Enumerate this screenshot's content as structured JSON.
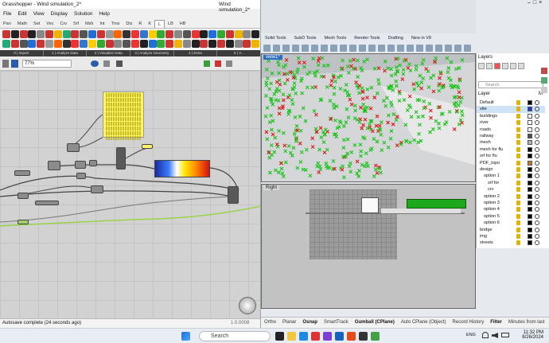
{
  "grasshopper": {
    "title": "Grasshopper - Wind simulation_2*",
    "doc_title": "Wind simulation_2*",
    "menu": [
      "File",
      "Edit",
      "View",
      "Display",
      "Solution",
      "Help"
    ],
    "tabs": [
      "Pan",
      "Math",
      "Set",
      "Vec",
      "Crv",
      "Srf",
      "Msh",
      "Int",
      "Trns",
      "Dis",
      "R",
      "K",
      "L",
      "LB",
      "HB"
    ],
    "active_tab": "L",
    "groups": [
      "0 | Import",
      "1 | Analyze Data",
      "2 | Visualize Data",
      "3 | Analyze Geometry",
      "4 | Extra",
      "5 | V..."
    ],
    "zoom": "77%",
    "status": "Autosave complete (24 seconds ago)",
    "version": "1.0.0008"
  },
  "rhino": {
    "tabs": [
      "Solid Tools",
      "SubD Tools",
      "Mesh Tools",
      "Render Tools",
      "Drafting",
      "New in V8"
    ],
    "viewport_top": "view1*",
    "viewport_bottom": "Right",
    "status_items": [
      "Ortho",
      "Planar",
      "Osnap",
      "SmartTrack",
      "Gumball (CPlane)",
      "Auto CPlane (Object)",
      "Record History",
      "Filter",
      "Minutes from last"
    ],
    "status_bold": [
      "Osnap",
      "Gumball (CPlane)",
      "Filter"
    ]
  },
  "layers": {
    "title": "Layers",
    "search_placeholder": "Search",
    "header_label": "Layer",
    "header_m": "M",
    "rows": [
      {
        "name": "Default",
        "indent": 0,
        "color": "#000000"
      },
      {
        "name": "site",
        "indent": 0,
        "color": "#1f3cc9",
        "selected": true
      },
      {
        "name": "buildings",
        "indent": 0,
        "color": "#ffffff"
      },
      {
        "name": "river",
        "indent": 0,
        "color": "#ffffff"
      },
      {
        "name": "roads",
        "indent": 0,
        "color": "#ffffff"
      },
      {
        "name": "railway",
        "indent": 0,
        "color": "#4f4f4f"
      },
      {
        "name": "mesh",
        "indent": 0,
        "color": "#b0b0b0"
      },
      {
        "name": "mesh for flu",
        "indent": 0,
        "color": "#000000"
      },
      {
        "name": "srf for flu",
        "indent": 0,
        "color": "#000000"
      },
      {
        "name": "PDF_topo",
        "indent": 0,
        "color": "#c07a2a"
      },
      {
        "name": "design",
        "indent": 0,
        "color": "#000000"
      },
      {
        "name": "option 1",
        "indent": 1,
        "color": "#000000"
      },
      {
        "name": "srf for",
        "indent": 2,
        "color": "#000000"
      },
      {
        "name": "crv",
        "indent": 2,
        "color": "#000000"
      },
      {
        "name": "option 2",
        "indent": 1,
        "color": "#000000"
      },
      {
        "name": "option 3",
        "indent": 1,
        "color": "#000000"
      },
      {
        "name": "option 4",
        "indent": 1,
        "color": "#000000"
      },
      {
        "name": "option 5",
        "indent": 1,
        "color": "#000000"
      },
      {
        "name": "option 6",
        "indent": 1,
        "color": "#000000"
      },
      {
        "name": "bridge",
        "indent": 0,
        "color": "#000000"
      },
      {
        "name": "img",
        "indent": 0,
        "color": "#000000"
      },
      {
        "name": "streets",
        "indent": 0,
        "color": "#000000"
      }
    ]
  },
  "taskbar": {
    "search_label": "Search",
    "lang": "ENG",
    "time": "11:32 PM",
    "date": "8/26/2024"
  }
}
